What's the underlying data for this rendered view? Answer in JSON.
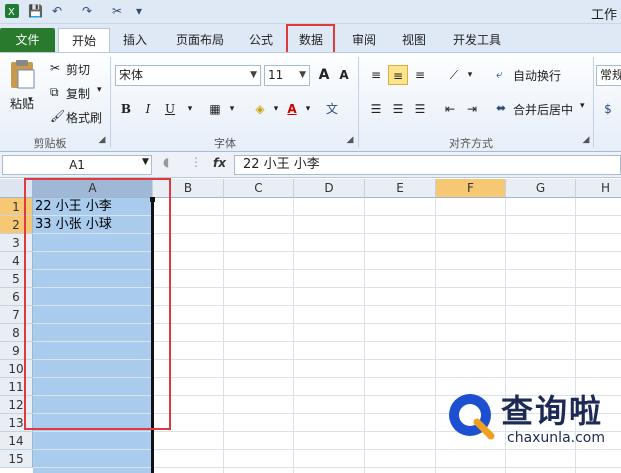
{
  "app": {
    "title": "工作"
  },
  "qat": {
    "save": "💾",
    "undo": "↶",
    "redo": "↷",
    "more": "▾"
  },
  "tabs": [
    "文件",
    "开始",
    "插入",
    "页面布局",
    "公式",
    "数据",
    "审阅",
    "视图",
    "开发工具"
  ],
  "ribbon": {
    "clipboard": {
      "paste": "粘贴",
      "cut": "剪切",
      "copy": "复制",
      "format_painter": "格式刷",
      "label": "剪贴板"
    },
    "font": {
      "family": "宋体",
      "size": "11",
      "bold": "B",
      "italic": "I",
      "underline": "U",
      "label": "字体",
      "grow": "A",
      "shrink": "A"
    },
    "alignment": {
      "wrap_text": "自动换行",
      "merge_center": "合并后居中",
      "label": "对齐方式"
    },
    "number": {
      "format": "常规"
    }
  },
  "formula_bar": {
    "name_box": "A1",
    "fx": "fx",
    "content": "22 小王 小李"
  },
  "grid": {
    "columns": [
      "A",
      "B",
      "C",
      "D",
      "E",
      "F",
      "G",
      "H"
    ],
    "rows": [
      "1",
      "2",
      "3",
      "4",
      "5",
      "6",
      "7",
      "8",
      "9",
      "10",
      "11",
      "12",
      "13",
      "14",
      "15"
    ],
    "cells": [
      {
        "ref": "A1",
        "value": "22 小王 小李"
      },
      {
        "ref": "A2",
        "value": "33 小张 小球"
      }
    ],
    "active_column": "F"
  },
  "watermark": {
    "name": "查询啦",
    "url": "chaxunla.com"
  },
  "colors": {
    "selection": "#a9cbee",
    "highlight_box": "#e0393e",
    "file_tab": "#2a7a2e"
  }
}
